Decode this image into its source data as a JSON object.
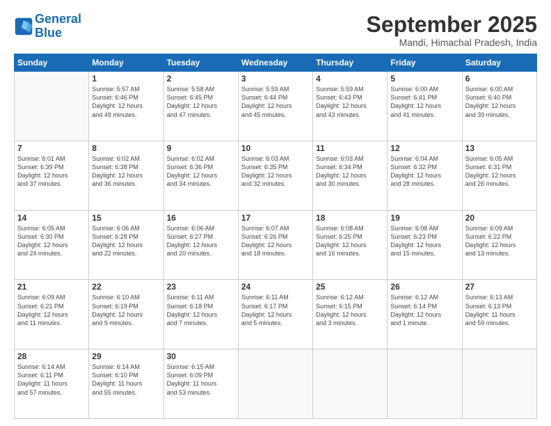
{
  "logo": {
    "line1": "General",
    "line2": "Blue"
  },
  "title": "September 2025",
  "subtitle": "Mandi, Himachal Pradesh, India",
  "weekdays": [
    "Sunday",
    "Monday",
    "Tuesday",
    "Wednesday",
    "Thursday",
    "Friday",
    "Saturday"
  ],
  "weeks": [
    [
      {
        "day": "",
        "info": ""
      },
      {
        "day": "1",
        "info": "Sunrise: 5:57 AM\nSunset: 6:46 PM\nDaylight: 12 hours\nand 49 minutes."
      },
      {
        "day": "2",
        "info": "Sunrise: 5:58 AM\nSunset: 6:45 PM\nDaylight: 12 hours\nand 47 minutes."
      },
      {
        "day": "3",
        "info": "Sunrise: 5:59 AM\nSunset: 6:44 PM\nDaylight: 12 hours\nand 45 minutes."
      },
      {
        "day": "4",
        "info": "Sunrise: 5:59 AM\nSunset: 6:43 PM\nDaylight: 12 hours\nand 43 minutes."
      },
      {
        "day": "5",
        "info": "Sunrise: 6:00 AM\nSunset: 6:41 PM\nDaylight: 12 hours\nand 41 minutes."
      },
      {
        "day": "6",
        "info": "Sunrise: 6:00 AM\nSunset: 6:40 PM\nDaylight: 12 hours\nand 39 minutes."
      }
    ],
    [
      {
        "day": "7",
        "info": "Sunrise: 6:01 AM\nSunset: 6:39 PM\nDaylight: 12 hours\nand 37 minutes."
      },
      {
        "day": "8",
        "info": "Sunrise: 6:02 AM\nSunset: 6:38 PM\nDaylight: 12 hours\nand 36 minutes."
      },
      {
        "day": "9",
        "info": "Sunrise: 6:02 AM\nSunset: 6:36 PM\nDaylight: 12 hours\nand 34 minutes."
      },
      {
        "day": "10",
        "info": "Sunrise: 6:03 AM\nSunset: 6:35 PM\nDaylight: 12 hours\nand 32 minutes."
      },
      {
        "day": "11",
        "info": "Sunrise: 6:03 AM\nSunset: 6:34 PM\nDaylight: 12 hours\nand 30 minutes."
      },
      {
        "day": "12",
        "info": "Sunrise: 6:04 AM\nSunset: 6:32 PM\nDaylight: 12 hours\nand 28 minutes."
      },
      {
        "day": "13",
        "info": "Sunrise: 6:05 AM\nSunset: 6:31 PM\nDaylight: 12 hours\nand 26 minutes."
      }
    ],
    [
      {
        "day": "14",
        "info": "Sunrise: 6:05 AM\nSunset: 6:30 PM\nDaylight: 12 hours\nand 24 minutes."
      },
      {
        "day": "15",
        "info": "Sunrise: 6:06 AM\nSunset: 6:28 PM\nDaylight: 12 hours\nand 22 minutes."
      },
      {
        "day": "16",
        "info": "Sunrise: 6:06 AM\nSunset: 6:27 PM\nDaylight: 12 hours\nand 20 minutes."
      },
      {
        "day": "17",
        "info": "Sunrise: 6:07 AM\nSunset: 6:26 PM\nDaylight: 12 hours\nand 18 minutes."
      },
      {
        "day": "18",
        "info": "Sunrise: 6:08 AM\nSunset: 6:25 PM\nDaylight: 12 hours\nand 16 minutes."
      },
      {
        "day": "19",
        "info": "Sunrise: 6:08 AM\nSunset: 6:23 PM\nDaylight: 12 hours\nand 15 minutes."
      },
      {
        "day": "20",
        "info": "Sunrise: 6:09 AM\nSunset: 6:22 PM\nDaylight: 12 hours\nand 13 minutes."
      }
    ],
    [
      {
        "day": "21",
        "info": "Sunrise: 6:09 AM\nSunset: 6:21 PM\nDaylight: 12 hours\nand 11 minutes."
      },
      {
        "day": "22",
        "info": "Sunrise: 6:10 AM\nSunset: 6:19 PM\nDaylight: 12 hours\nand 9 minutes."
      },
      {
        "day": "23",
        "info": "Sunrise: 6:11 AM\nSunset: 6:18 PM\nDaylight: 12 hours\nand 7 minutes."
      },
      {
        "day": "24",
        "info": "Sunrise: 6:11 AM\nSunset: 6:17 PM\nDaylight: 12 hours\nand 5 minutes."
      },
      {
        "day": "25",
        "info": "Sunrise: 6:12 AM\nSunset: 6:15 PM\nDaylight: 12 hours\nand 3 minutes."
      },
      {
        "day": "26",
        "info": "Sunrise: 6:12 AM\nSunset: 6:14 PM\nDaylight: 12 hours\nand 1 minute."
      },
      {
        "day": "27",
        "info": "Sunrise: 6:13 AM\nSunset: 6:13 PM\nDaylight: 11 hours\nand 59 minutes."
      }
    ],
    [
      {
        "day": "28",
        "info": "Sunrise: 6:14 AM\nSunset: 6:11 PM\nDaylight: 11 hours\nand 57 minutes."
      },
      {
        "day": "29",
        "info": "Sunrise: 6:14 AM\nSunset: 6:10 PM\nDaylight: 11 hours\nand 55 minutes."
      },
      {
        "day": "30",
        "info": "Sunrise: 6:15 AM\nSunset: 6:09 PM\nDaylight: 11 hours\nand 53 minutes."
      },
      {
        "day": "",
        "info": ""
      },
      {
        "day": "",
        "info": ""
      },
      {
        "day": "",
        "info": ""
      },
      {
        "day": "",
        "info": ""
      }
    ]
  ]
}
